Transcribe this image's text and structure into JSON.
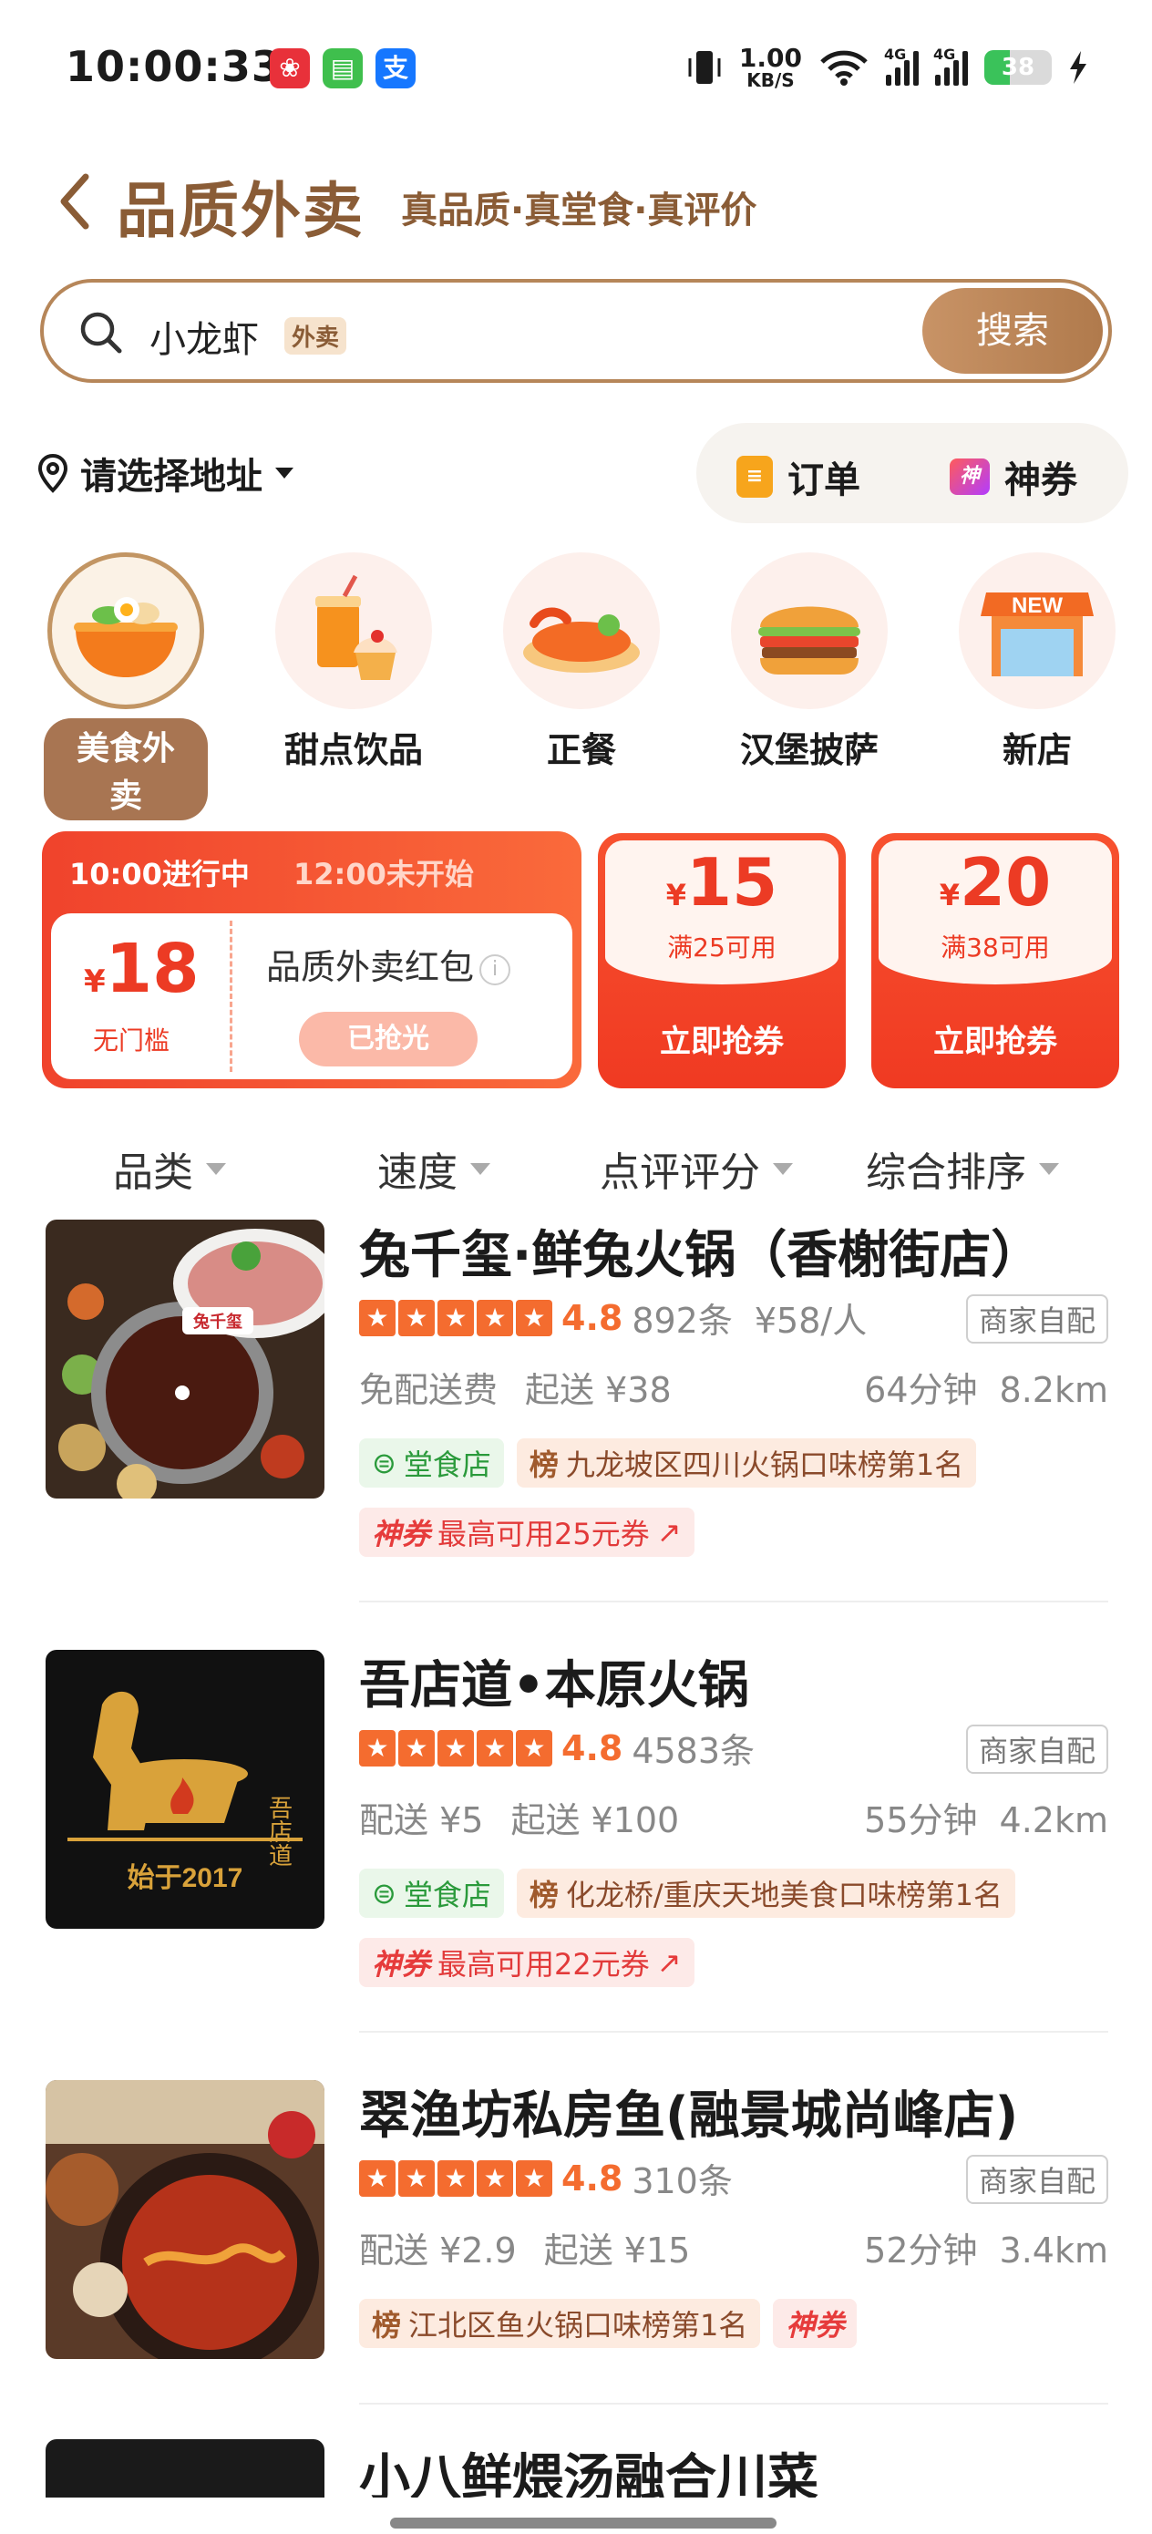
{
  "status": {
    "time": "10:00:33",
    "net_speed_value": "1.00",
    "net_speed_unit": "KB/S",
    "net1": "4G",
    "net2": "4G",
    "battery": "38",
    "apps": [
      {
        "icon": "red-app-icon",
        "color": "#e8313a",
        "glyph": "❀"
      },
      {
        "icon": "green-chat-icon",
        "color": "#3fbf4d",
        "glyph": "▤"
      },
      {
        "icon": "alipay-icon",
        "color": "#1677ff",
        "glyph": "支"
      }
    ]
  },
  "header": {
    "title": "品质外卖",
    "slogan": "真品质·真堂食·真评价"
  },
  "search": {
    "value": "小龙虾",
    "tag": "外卖",
    "button": "搜索"
  },
  "address": {
    "label": "请选择地址"
  },
  "quick": {
    "orders": "订单",
    "coupons": "神券",
    "coupon_icon_text": "神"
  },
  "categories": [
    {
      "label": "美食外卖",
      "selected": true
    },
    {
      "label": "甜点饮品",
      "selected": false
    },
    {
      "label": "正餐",
      "selected": false
    },
    {
      "label": "汉堡披萨",
      "selected": false
    },
    {
      "label": "新店",
      "selected": false,
      "badge": "NEW"
    }
  ],
  "promo": {
    "session_now": "10:00进行中",
    "session_next": "12:00未开始",
    "main": {
      "currency": "¥",
      "amount": "18",
      "condition": "无门槛",
      "name": "品质外卖红包",
      "status": "已抢光"
    },
    "coupons": [
      {
        "currency": "¥",
        "amount": "15",
        "condition": "满25可用",
        "action": "立即抢券"
      },
      {
        "currency": "¥",
        "amount": "20",
        "condition": "满38可用",
        "action": "立即抢券"
      }
    ]
  },
  "sort": [
    "品类",
    "速度",
    "点评评分",
    "综合排序"
  ],
  "shops": [
    {
      "name": "兔千玺·鲜兔火锅（香榭街店）",
      "score": "4.8",
      "reviews": "892条",
      "avg": "¥58/人",
      "delivery_mode": "商家自配",
      "fee": "免配送费",
      "min": "起送 ¥38",
      "time": "64分钟",
      "distance": "8.2km",
      "dine_in": "堂食店",
      "rank_icon": "榜",
      "rank": "九龙坡区四川火锅口味榜第1名",
      "coupon_tag": "神券",
      "coupon_text": "最高可用25元券",
      "image_caption": "兔千玺"
    },
    {
      "name": "吾店道•本原火锅",
      "score": "4.8",
      "reviews": "4583条",
      "avg": "",
      "delivery_mode": "商家自配",
      "fee": "配送 ¥5",
      "min": "起送 ¥100",
      "time": "55分钟",
      "distance": "4.2km",
      "dine_in": "堂食店",
      "rank_icon": "榜",
      "rank": "化龙桥/重庆天地美食口味榜第1名",
      "coupon_tag": "神券",
      "coupon_text": "最高可用22元券",
      "image_caption": "始于2017"
    },
    {
      "name": "翠渔坊私房鱼(融景城尚峰店)",
      "score": "4.8",
      "reviews": "310条",
      "avg": "",
      "delivery_mode": "商家自配",
      "fee": "配送 ¥2.9",
      "min": "起送 ¥15",
      "time": "52分钟",
      "distance": "3.4km",
      "rank_icon": "榜",
      "rank": "江北区鱼火锅口味榜第1名",
      "coupon_tag": "神券"
    },
    {
      "name": "小八鲜煨汤融合川菜"
    }
  ]
}
